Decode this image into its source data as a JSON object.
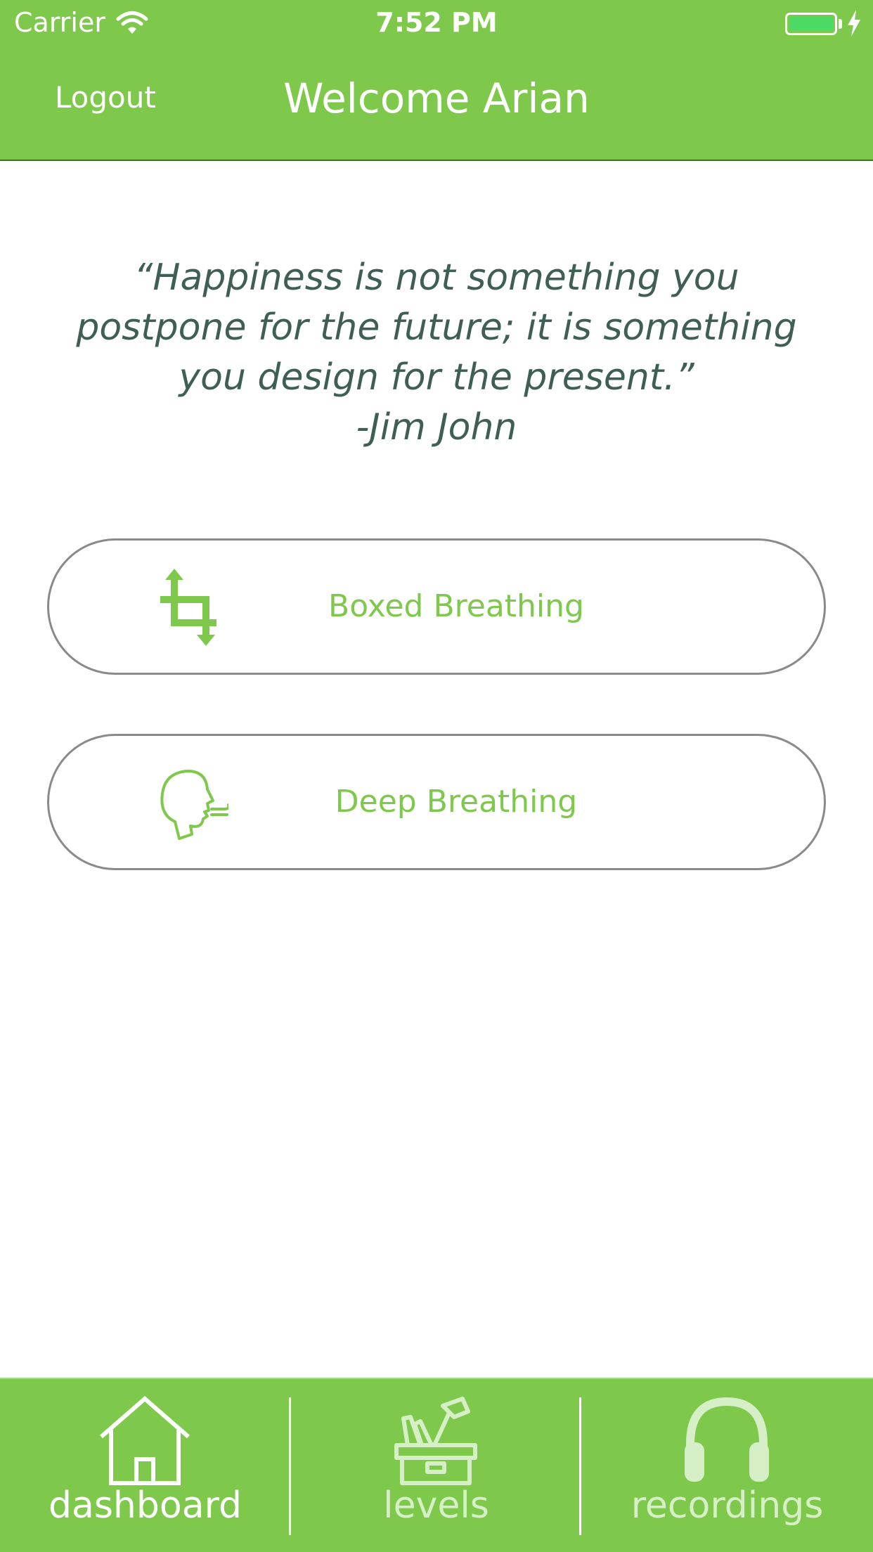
{
  "status_bar": {
    "carrier": "Carrier",
    "time": "7:52 PM"
  },
  "nav": {
    "left_button": "Logout",
    "title": "Welcome Arian"
  },
  "quote": {
    "lines": [
      "“Happiness is not something you",
      "postpone for the future; it is something",
      "you design for the present.”"
    ],
    "author": "-Jim John"
  },
  "exercises": [
    {
      "label": "Boxed Breathing",
      "icon": "crop-arrows-icon"
    },
    {
      "label": "Deep Breathing",
      "icon": "breathing-face-icon"
    }
  ],
  "tabs": [
    {
      "label": "dashboard",
      "icon": "house-icon",
      "selected": true
    },
    {
      "label": "levels",
      "icon": "toolbox-icon",
      "selected": false
    },
    {
      "label": "recordings",
      "icon": "headphones-icon",
      "selected": false
    }
  ],
  "colors": {
    "brand_green": "#7ec94b",
    "quote_text": "#3e5e56",
    "battery": "#4cd964"
  }
}
